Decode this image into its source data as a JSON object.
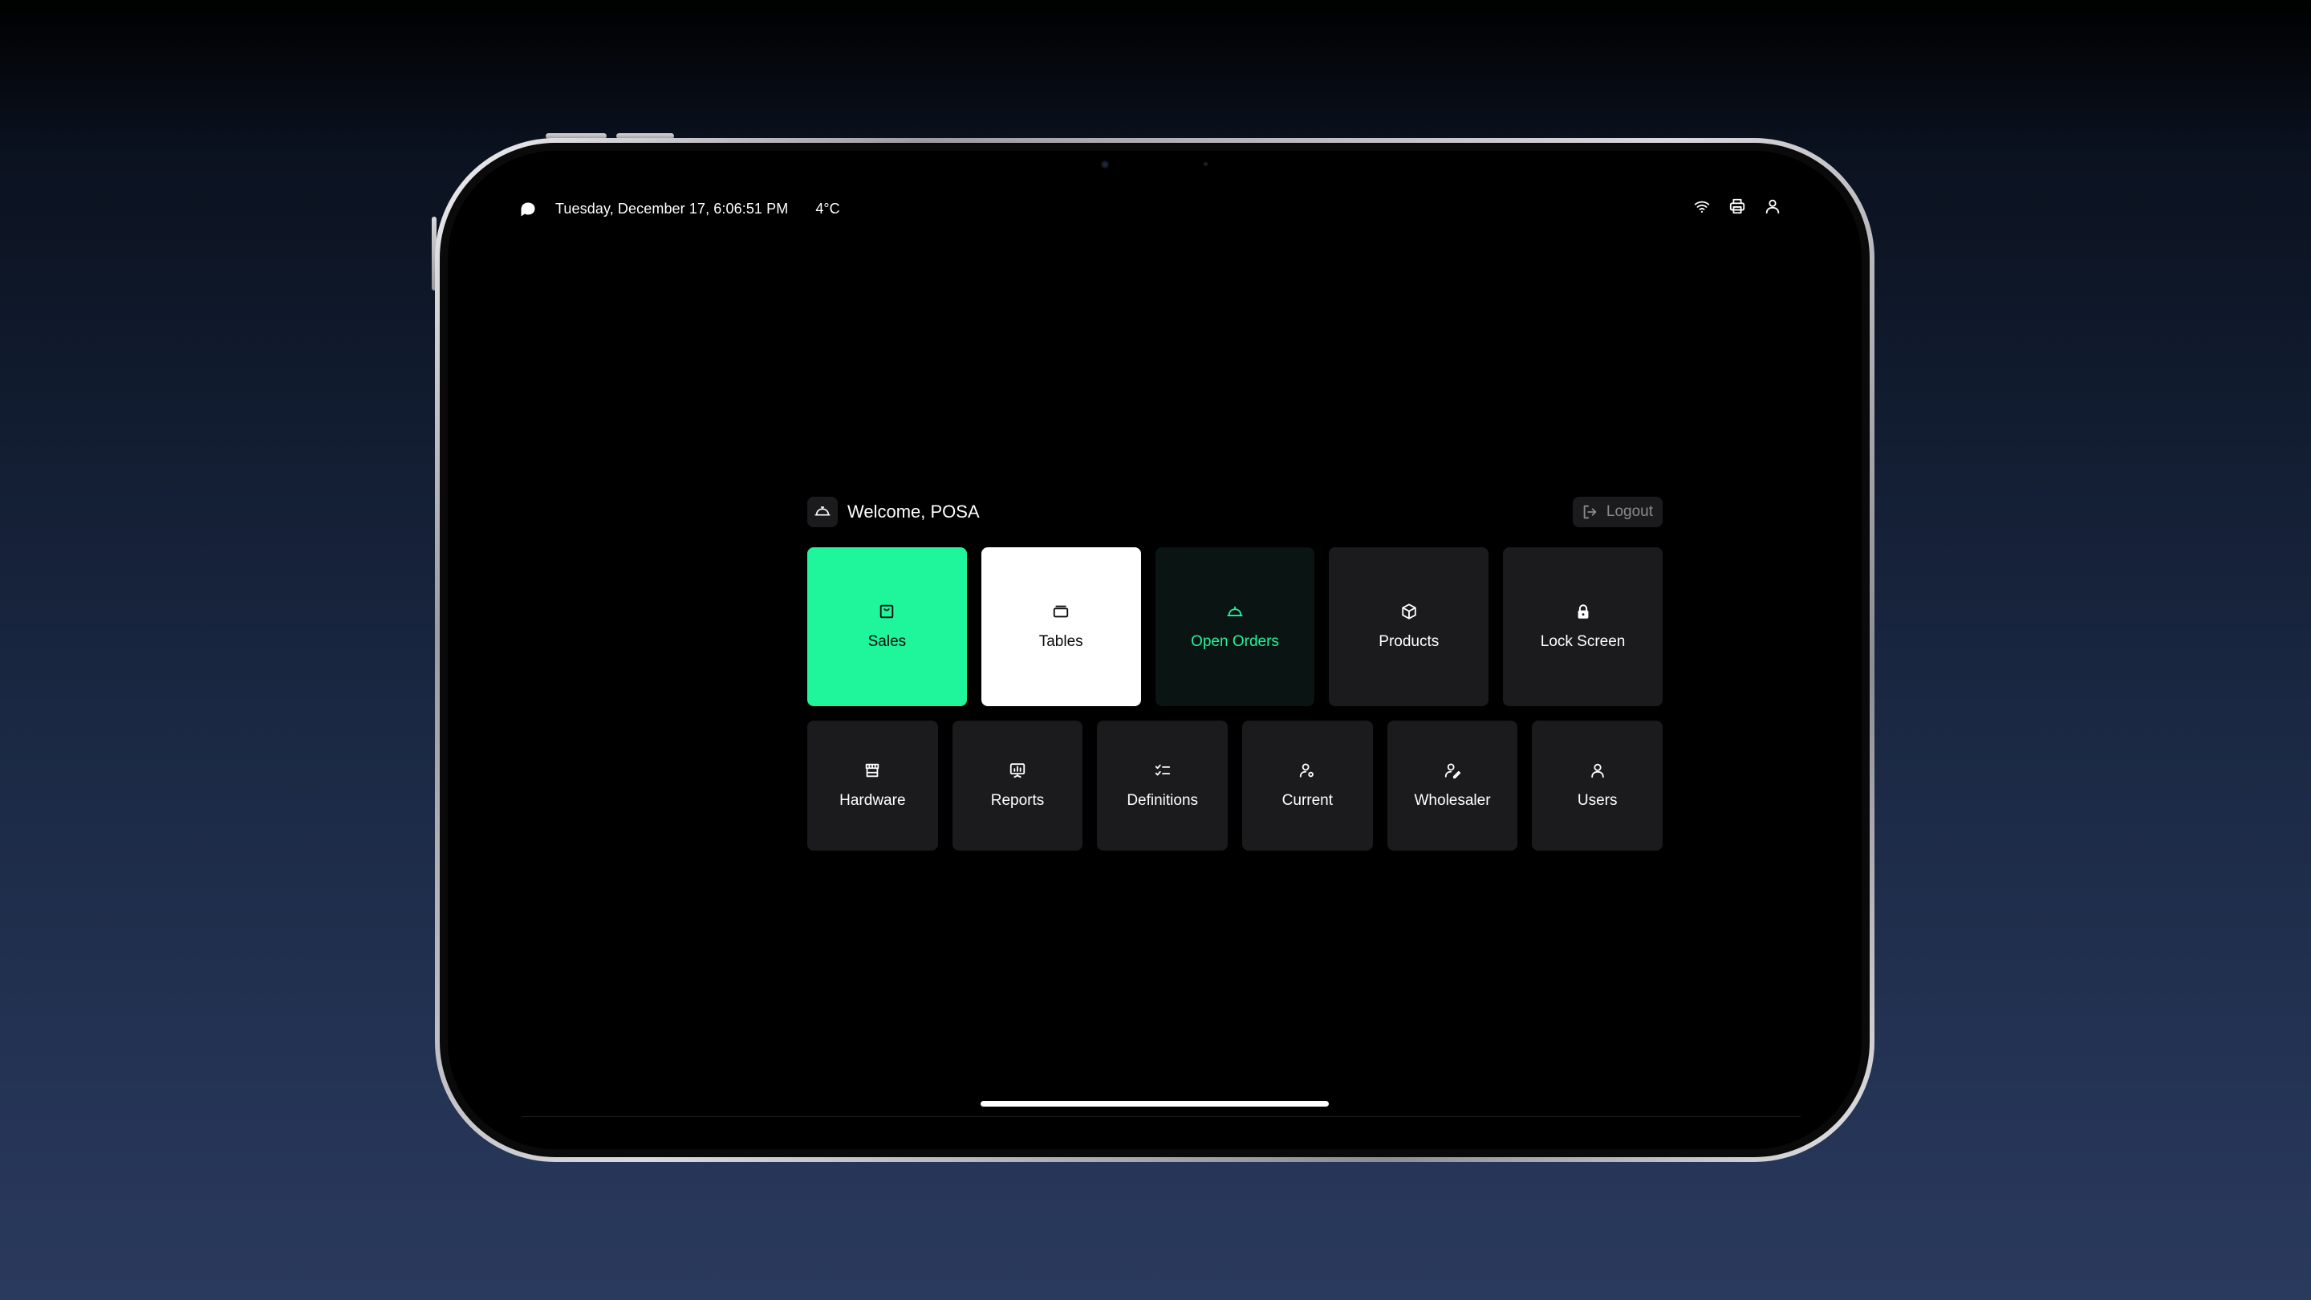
{
  "status_bar": {
    "datetime": "Tuesday, December 17, 6:06:51 PM",
    "temperature": "4°C",
    "icons": [
      "logo-icon",
      "wifi-icon",
      "printer-icon",
      "user-icon"
    ]
  },
  "header": {
    "welcome": "Welcome, POSA",
    "logout_label": "Logout"
  },
  "tiles_row1": [
    {
      "label": "Sales",
      "icon": "shopping-bag-icon"
    },
    {
      "label": "Tables",
      "icon": "table-icon"
    },
    {
      "label": "Open Orders",
      "icon": "cloche-icon"
    },
    {
      "label": "Products",
      "icon": "box-icon"
    },
    {
      "label": "Lock Screen",
      "icon": "lock-icon"
    }
  ],
  "tiles_row2": [
    {
      "label": "Hardware",
      "icon": "store-icon"
    },
    {
      "label": "Reports",
      "icon": "presentation-chart-icon"
    },
    {
      "label": "Definitions",
      "icon": "checklist-icon"
    },
    {
      "label": "Current",
      "icon": "user-settings-icon"
    },
    {
      "label": "Wholesaler",
      "icon": "user-edit-icon"
    },
    {
      "label": "Users",
      "icon": "user-icon"
    }
  ],
  "colors": {
    "accent": "#1ff59b",
    "tile_bg": "#1b1b1d",
    "screen_bg": "#000000"
  }
}
